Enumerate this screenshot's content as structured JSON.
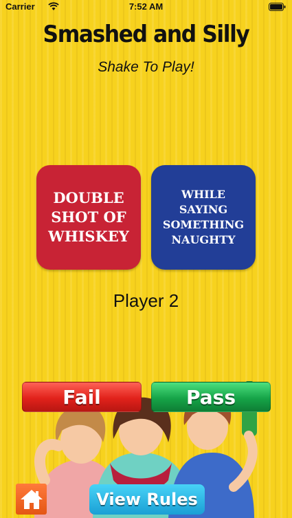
{
  "status_bar": {
    "carrier": "Carrier",
    "time": "7:52 AM"
  },
  "header": {
    "title": "Smashed and Silly",
    "subtitle": "Shake To Play!"
  },
  "cards": [
    {
      "text": "DOUBLE\nSHOT OF\nWHISKEY",
      "color": "#c82335"
    },
    {
      "text": "WHILE SAYING\nSOMETHING\nNAUGHTY",
      "color": "#223e97"
    }
  ],
  "player_label": "Player 2",
  "actions": {
    "fail_label": "Fail",
    "pass_label": "Pass"
  },
  "footer": {
    "home_icon": "home-icon",
    "rules_label": "View Rules"
  },
  "colors": {
    "background": "#f7d21e",
    "fail": "#e1221b",
    "pass": "#16a448",
    "rules": "#1a9fd4",
    "home": "#e45614"
  }
}
